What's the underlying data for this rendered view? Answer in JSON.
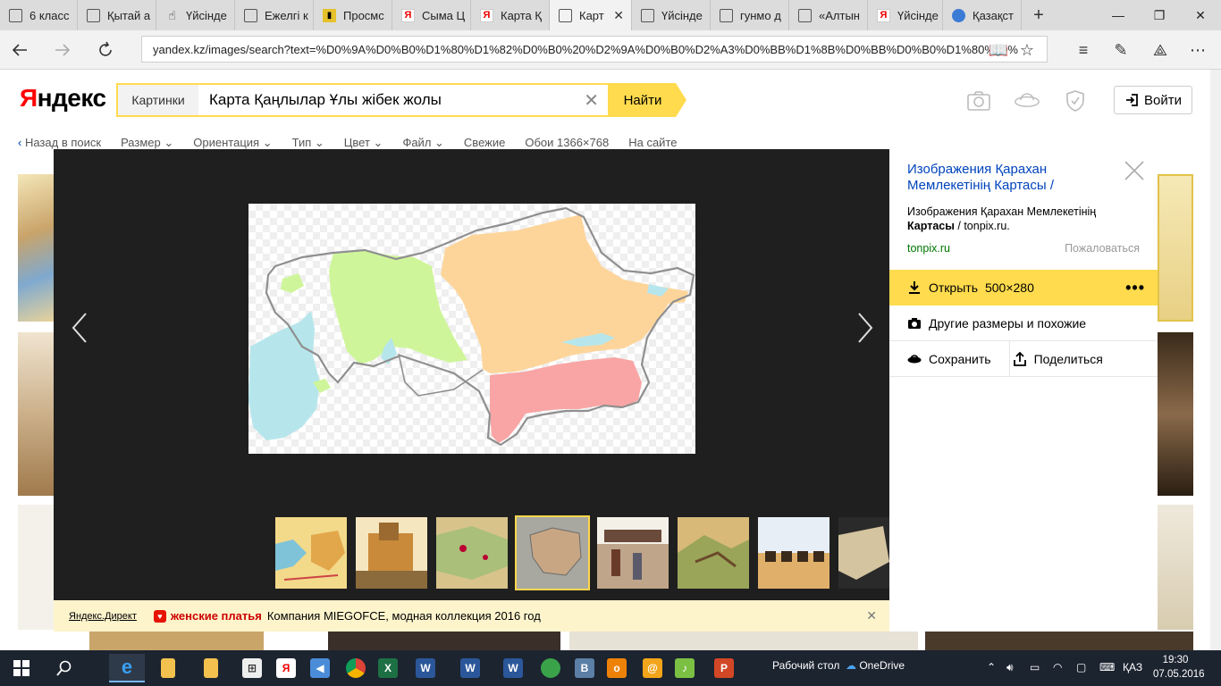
{
  "browser": {
    "tabs": [
      {
        "title": "6 класс",
        "icon": "page-icon"
      },
      {
        "title": "Қытай а",
        "icon": "page-icon"
      },
      {
        "title": "Үйсінде",
        "icon": "hand-icon"
      },
      {
        "title": "Ежелгі к",
        "icon": "page-icon"
      },
      {
        "title": "Просмс",
        "icon": "document-icon"
      },
      {
        "title": "Сыма Ц",
        "icon": "yandex-icon"
      },
      {
        "title": "Карта Қ",
        "icon": "yandex-icon"
      },
      {
        "title": "Карт",
        "icon": "page-icon",
        "active": true
      },
      {
        "title": "Үйсінде",
        "icon": "page-icon"
      },
      {
        "title": "гунмо д",
        "icon": "page-icon"
      },
      {
        "title": "«Алтын",
        "icon": "page-icon"
      },
      {
        "title": "Үйсінде",
        "icon": "yandex-icon"
      },
      {
        "title": "Қазақст",
        "icon": "globe-icon"
      }
    ],
    "url": "yandex.kz/images/search?text=%D0%9A%D0%B0%D1%80%D1%82%D0%B0%20%D2%9A%D0%B0%D2%A3%D0%BB%D1%8B%D0%BB%D0%B0%D1%80%20%"
  },
  "yandex": {
    "logo": "Яндекс",
    "search_prefix": "Картинки",
    "query": "Карта Қаңлылар Ұлы жібек жолы",
    "find_button": "Найти",
    "login_button": "Войти"
  },
  "filters": [
    "Назад в поиск",
    "Размер",
    "Ориентация",
    "Тип",
    "Цвет",
    "Файл",
    "Свежие",
    "Обои 1366×768",
    "На сайте"
  ],
  "panel": {
    "title": "Изображения Қарахан Мемлекетінің Картасы /",
    "desc_prefix": "Изображения Қарахан Мемлекетінің ",
    "desc_bold": "Картасы",
    "desc_suffix": " / tonpix.ru.",
    "site": "tonpix.ru",
    "complain": "Пожаловаться",
    "open_label": "Открыть",
    "open_size": "500×280",
    "similar": "Другие размеры и похожие",
    "save": "Сохранить",
    "share": "Поделиться"
  },
  "ad": {
    "label": "Яндекс.Директ",
    "title": "женские платья",
    "text": "Компания MIEGOFCE, модная коллекция 2016 год"
  },
  "taskbar": {
    "desktop_label": "Рабочий стол",
    "onedrive_label": "OneDrive",
    "lang": "ҚАЗ",
    "time": "19:30",
    "date": "07.05.2016"
  },
  "colors": {
    "accent_yellow": "#ffdb4d",
    "link_blue": "#0044bb",
    "site_green": "#007700"
  }
}
